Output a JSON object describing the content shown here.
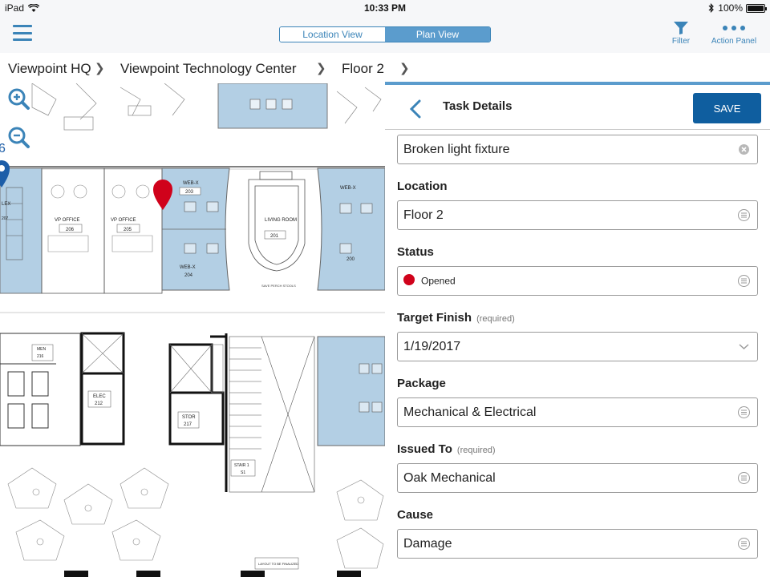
{
  "status_bar": {
    "device": "iPad",
    "time": "10:33 PM",
    "battery": "100%",
    "battery_level": 1.0
  },
  "nav": {
    "view_toggle": {
      "options": [
        "Location View",
        "Plan View"
      ],
      "selected": "Plan View"
    },
    "filter_label": "Filter",
    "action_panel_label": "Action Panel"
  },
  "breadcrumb": {
    "items": [
      "Viewpoint HQ",
      "Viewpoint Technology Center",
      "Floor 2"
    ]
  },
  "map": {
    "partial_marker_label": "6",
    "rooms": {
      "vp_office_1": {
        "name": "VP OFFICE",
        "number": "206"
      },
      "vp_office_2": {
        "name": "VP OFFICE",
        "number": "205"
      },
      "webx_top": {
        "name": "WEB-X",
        "number": "203"
      },
      "webx_bottom": {
        "name": "WEB-X",
        "number": "204"
      },
      "living_room": {
        "name": "LIVING ROOM",
        "number": "201"
      },
      "webx_right": {
        "name": "WEB-X",
        "number": "200"
      },
      "men": {
        "name": "MEN",
        "number": "216"
      },
      "elec": {
        "name": "ELEC",
        "number": "212"
      },
      "stor": {
        "name": "STOR",
        "number": "217"
      },
      "stair": {
        "name": "STAIR 1",
        "number": "S1"
      },
      "lex": {
        "name": "LEX",
        "number": "207"
      }
    },
    "annotations": {
      "stools": "SAVE PERCH STOOLS",
      "layout": "LAYOUT TO BE FINALIZED"
    }
  },
  "task": {
    "header_title": "Task Details",
    "save_label": "SAVE",
    "description_value": "Broken light fixture",
    "location": {
      "label": "Location",
      "value": "Floor 2"
    },
    "status": {
      "label": "Status",
      "value": "Opened",
      "color": "#d0021b"
    },
    "target_finish": {
      "label": "Target Finish",
      "required": "(required)",
      "value": "1/19/2017"
    },
    "package": {
      "label": "Package",
      "value": "Mechanical & Electrical"
    },
    "issued_to": {
      "label": "Issued To",
      "required": "(required)",
      "value": "Oak Mechanical"
    },
    "cause": {
      "label": "Cause",
      "value": "Damage"
    }
  },
  "colors": {
    "accent": "#3b84b8",
    "save_button": "#0f5e9f",
    "room_fill": "#b3cfe4",
    "marker_red": "#d0021b",
    "marker_blue": "#1d5ea8"
  }
}
